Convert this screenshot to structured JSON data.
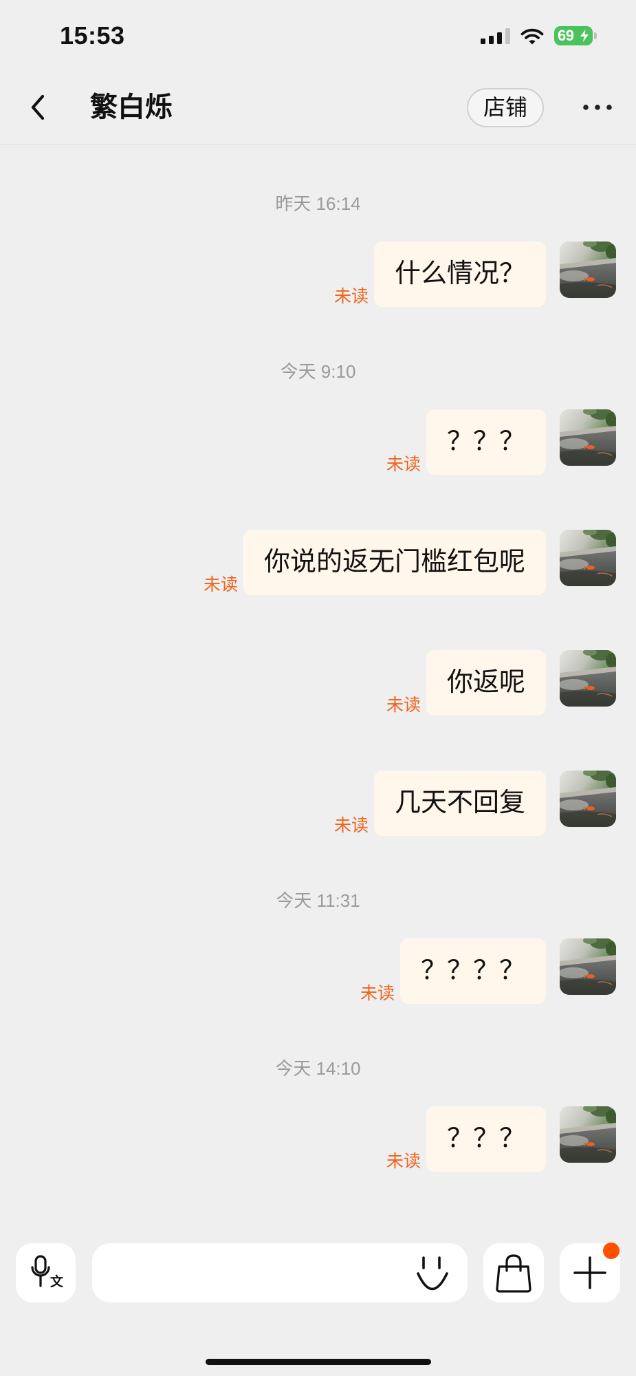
{
  "status_bar": {
    "time": "15:53",
    "battery_level": "69",
    "icons": {
      "signal": "cellular-signal-icon",
      "wifi": "wifi-icon",
      "battery": "battery-charging-icon"
    },
    "battery_color": "#4bc35c"
  },
  "header": {
    "back_icon": "chevron-left-icon",
    "title": "繁白烁",
    "shop_button_label": "店铺",
    "more_icon": "more-dots-icon"
  },
  "chat": {
    "items": [
      {
        "type": "timestamp",
        "text": "昨天 16:14"
      },
      {
        "type": "message",
        "text": "什么情况？",
        "status": "未读"
      },
      {
        "type": "timestamp",
        "text": "今天 9:10"
      },
      {
        "type": "message",
        "text": "？？？",
        "status": "未读"
      },
      {
        "type": "message",
        "text": "你说的返无门槛红包呢",
        "status": "未读"
      },
      {
        "type": "message",
        "text": "你返呢",
        "status": "未读"
      },
      {
        "type": "message",
        "text": "几天不回复",
        "status": "未读"
      },
      {
        "type": "timestamp",
        "text": "今天 11:31"
      },
      {
        "type": "message",
        "text": "？？？？",
        "status": "未读"
      },
      {
        "type": "timestamp",
        "text": "今天 14:10"
      },
      {
        "type": "message",
        "text": "？？？",
        "status": "未读"
      }
    ]
  },
  "composer": {
    "voice_icon": "mic-translate-icon",
    "voice_icon_glyph": "文",
    "emoji_icon": "smiley-icon",
    "bag_icon": "shopping-bag-icon",
    "plus_icon": "plus-icon",
    "plus_has_badge": true
  },
  "theme": {
    "page_bg": "#efefef",
    "bubble_bg": "#fff7eb",
    "unread_color": "#f0631c",
    "timestamp_color": "#9b9b9b",
    "badge_color": "#ff5000"
  }
}
